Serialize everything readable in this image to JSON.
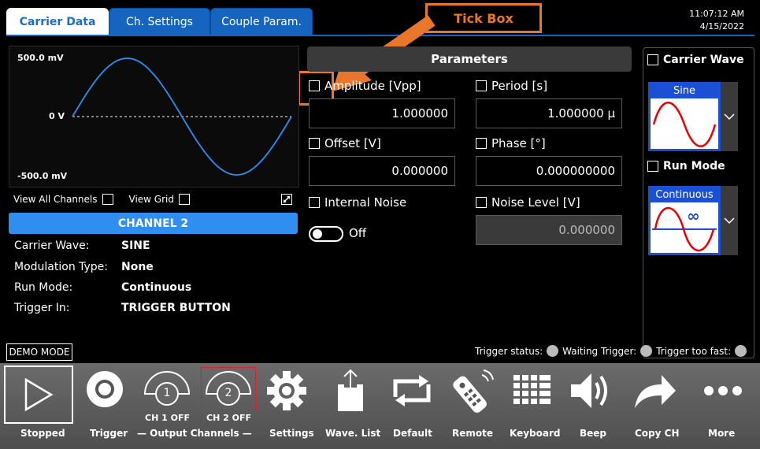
{
  "tabs": [
    {
      "label": "Carrier Data"
    },
    {
      "label": "Ch. Settings"
    },
    {
      "label": "Couple Param."
    }
  ],
  "callout": {
    "label": "Tick Box",
    "color": "#e9762b"
  },
  "datetime": {
    "time": "11:07:12 AM",
    "date": "4/15/2022"
  },
  "chart": {
    "y_top": "500.0 mV",
    "y_mid": "0 V",
    "y_bottom": "-500.0 mV",
    "view_all_channels": "View All Channels",
    "view_grid": "View Grid"
  },
  "chart_data": {
    "type": "line",
    "series": [
      {
        "values": "sine",
        "amplitude_mv": 500
      }
    ],
    "ylim": [
      -500,
      500
    ],
    "ticks": [
      "500.0 mV",
      "0 V",
      "-500.0 mV"
    ],
    "grid": false
  },
  "channel": {
    "title": "CHANNEL 2",
    "rows": [
      {
        "label": "Carrier Wave:",
        "value": "SINE"
      },
      {
        "label": "Modulation Type:",
        "value": "None"
      },
      {
        "label": "Run Mode:",
        "value": "Continuous"
      },
      {
        "label": "Trigger In:",
        "value": "TRIGGER BUTTON"
      }
    ]
  },
  "parameters": {
    "header": "Parameters",
    "amplitude": {
      "label": "Amplitude [Vpp]",
      "value": "1.000000"
    },
    "period": {
      "label": "Period [s]",
      "value": "1.000000 µ"
    },
    "offset": {
      "label": "Offset [V]",
      "value": "0.000000"
    },
    "phase": {
      "label": "Phase [°]",
      "value": "0.000000000"
    },
    "internal_noise": {
      "label": "Internal Noise",
      "toggle": "Off"
    },
    "noise_level": {
      "label": "Noise Level [V]",
      "value": "0.000000"
    }
  },
  "right_panel": {
    "carrier_wave": {
      "label": "Carrier Wave",
      "selected": "Sine"
    },
    "run_mode": {
      "label": "Run Mode",
      "selected": "Continuous"
    }
  },
  "status": {
    "demo": "DEMO MODE",
    "trigger_status": "Trigger status:",
    "waiting_trigger": "Waiting Trigger:",
    "trigger_too_fast": "Trigger too fast:"
  },
  "toolbar": {
    "stopped": "Stopped",
    "trigger": "Trigger",
    "output_channels": "— Output Channels —",
    "ch1": "CH 1 OFF",
    "ch2": "CH 2 OFF",
    "ch1_num": "1",
    "ch2_num": "2",
    "settings": "Settings",
    "wave_list": "Wave. List",
    "default": "Default",
    "remote": "Remote",
    "keyboard": "Keyboard",
    "beep": "Beep",
    "copy_ch": "Copy CH",
    "more": "More"
  }
}
